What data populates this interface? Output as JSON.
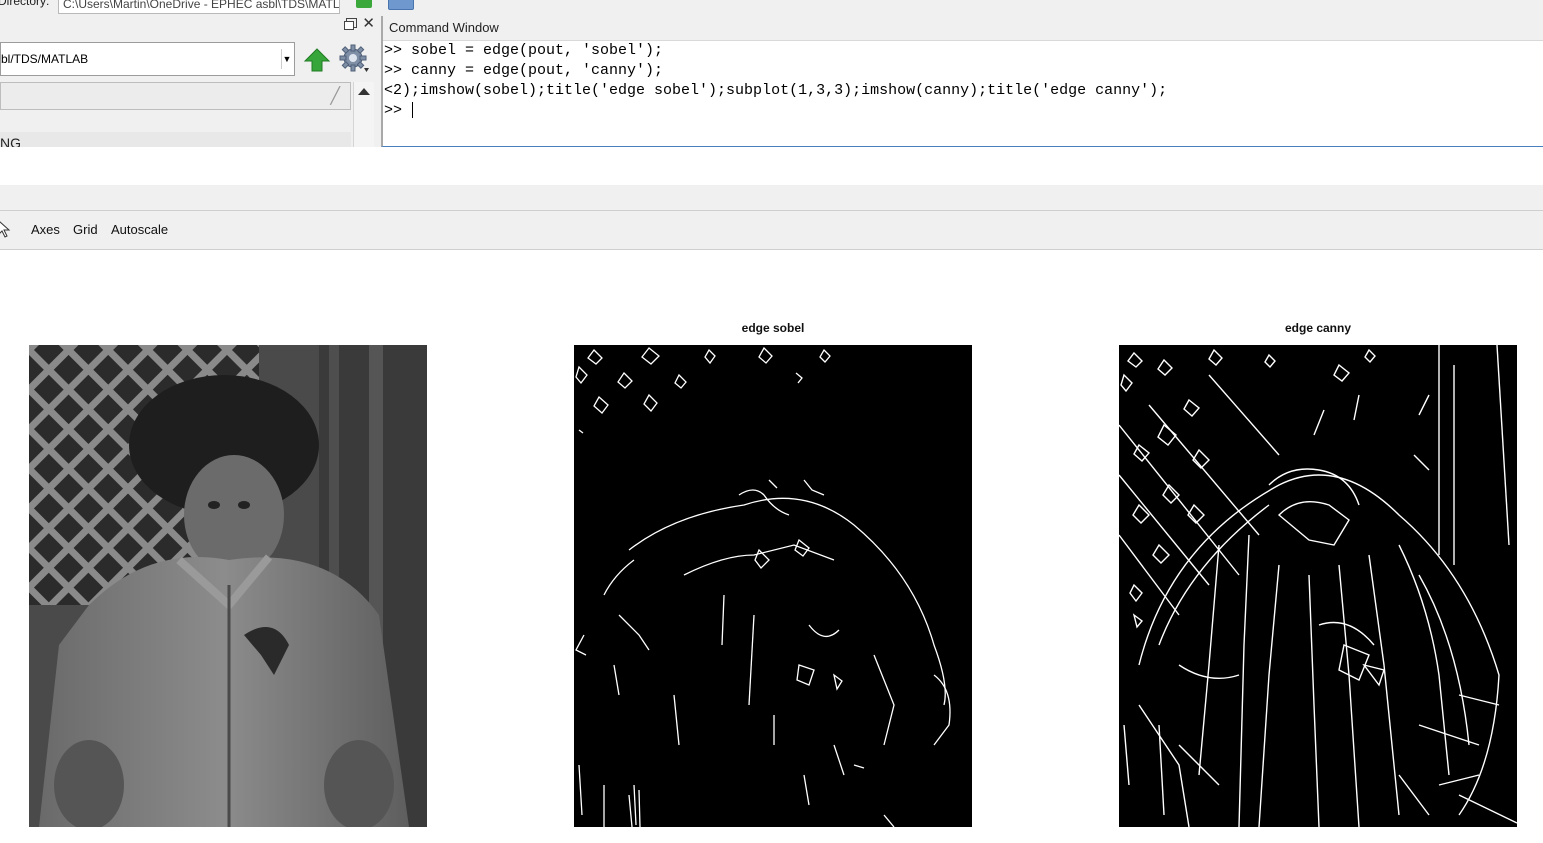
{
  "topbar": {
    "dir_label": "Directory:",
    "dir_path": "C:\\Users\\Martin\\OneDrive - EPHEC asbl\\TDS\\MATLAB"
  },
  "current_folder": {
    "address": "bl/TDS/MATLAB",
    "file_row": "NG"
  },
  "command_window": {
    "title": "Command Window",
    "lines": [
      ">> sobel = edge(pout, 'sobel');",
      ">> canny = edge(pout, 'canny');",
      "<2);imshow(sobel);title('edge sobel');subplot(1,3,3);imshow(canny);title('edge canny');",
      ">> "
    ]
  },
  "figure_toolbar": {
    "axes_label": "Axes",
    "grid_label": "Grid",
    "autoscale_label": "Autoscale"
  },
  "subplots": [
    {
      "title": "",
      "kind": "photo"
    },
    {
      "title": "edge sobel",
      "kind": "sobel"
    },
    {
      "title": "edge canny",
      "kind": "canny"
    }
  ],
  "colors": {
    "panel_bg": "#f0f0f0",
    "cmd_border": "#4a7fbf",
    "edge_bg": "#000000",
    "edge_fg": "#ffffff"
  }
}
